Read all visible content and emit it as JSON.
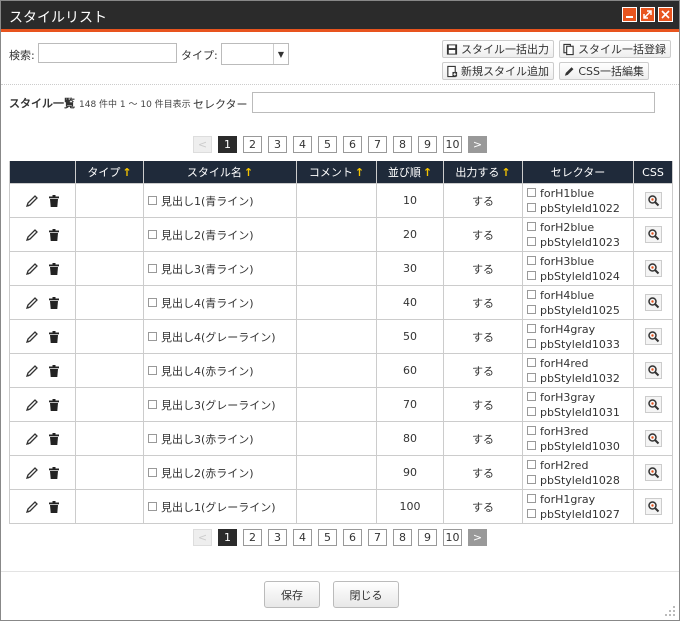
{
  "window": {
    "title": "スタイルリスト"
  },
  "search": {
    "label": "検索:",
    "value": "",
    "placeholder": ""
  },
  "type_filter": {
    "label": "タイプ:",
    "selected": ""
  },
  "actions": {
    "bulk_output": "スタイル一括出力",
    "bulk_register": "スタイル一括登録",
    "new_style": "新規スタイル追加",
    "css_bulk_edit": "CSS一括編集"
  },
  "list": {
    "heading": "スタイル一覧",
    "count_text": "148 件中 1 ～ 10 件目表示",
    "selector_label": "セレクター",
    "selector_value": ""
  },
  "pagination": {
    "prev": "<",
    "next": ">",
    "pages": [
      "1",
      "2",
      "3",
      "4",
      "5",
      "6",
      "7",
      "8",
      "9",
      "10"
    ],
    "current": "1"
  },
  "table": {
    "headers": {
      "actions": "",
      "type": "タイプ",
      "name": "スタイル名",
      "comment": "コメント",
      "order": "並び順",
      "output": "出力する",
      "selector": "セレクター",
      "css": "CSS"
    },
    "sort_arrow": "↑",
    "rows": [
      {
        "name": "見出し1(青ライン)",
        "comment": "",
        "type": "",
        "order": "10",
        "output": "する",
        "sel1": "forH1blue",
        "sel2": "pbStyleId1022"
      },
      {
        "name": "見出し2(青ライン)",
        "comment": "",
        "type": "",
        "order": "20",
        "output": "する",
        "sel1": "forH2blue",
        "sel2": "pbStyleId1023"
      },
      {
        "name": "見出し3(青ライン)",
        "comment": "",
        "type": "",
        "order": "30",
        "output": "する",
        "sel1": "forH3blue",
        "sel2": "pbStyleId1024"
      },
      {
        "name": "見出し4(青ライン)",
        "comment": "",
        "type": "",
        "order": "40",
        "output": "する",
        "sel1": "forH4blue",
        "sel2": "pbStyleId1025"
      },
      {
        "name": "見出し4(グレーライン)",
        "comment": "",
        "type": "",
        "order": "50",
        "output": "する",
        "sel1": "forH4gray",
        "sel2": "pbStyleId1033"
      },
      {
        "name": "見出し4(赤ライン)",
        "comment": "",
        "type": "",
        "order": "60",
        "output": "する",
        "sel1": "forH4red",
        "sel2": "pbStyleId1032"
      },
      {
        "name": "見出し3(グレーライン)",
        "comment": "",
        "type": "",
        "order": "70",
        "output": "する",
        "sel1": "forH3gray",
        "sel2": "pbStyleId1031"
      },
      {
        "name": "見出し3(赤ライン)",
        "comment": "",
        "type": "",
        "order": "80",
        "output": "する",
        "sel1": "forH3red",
        "sel2": "pbStyleId1030"
      },
      {
        "name": "見出し2(赤ライン)",
        "comment": "",
        "type": "",
        "order": "90",
        "output": "する",
        "sel1": "forH2red",
        "sel2": "pbStyleId1028"
      },
      {
        "name": "見出し1(グレーライン)",
        "comment": "",
        "type": "",
        "order": "100",
        "output": "する",
        "sel1": "forH1gray",
        "sel2": "pbStyleId1027"
      }
    ]
  },
  "footer": {
    "save": "保存",
    "close": "閉じる"
  },
  "colors": {
    "titlebar": "#2b2b2b",
    "accent": "#e8541e",
    "table_header": "#1f2a3a",
    "sort_arrow": "#f5c400"
  }
}
